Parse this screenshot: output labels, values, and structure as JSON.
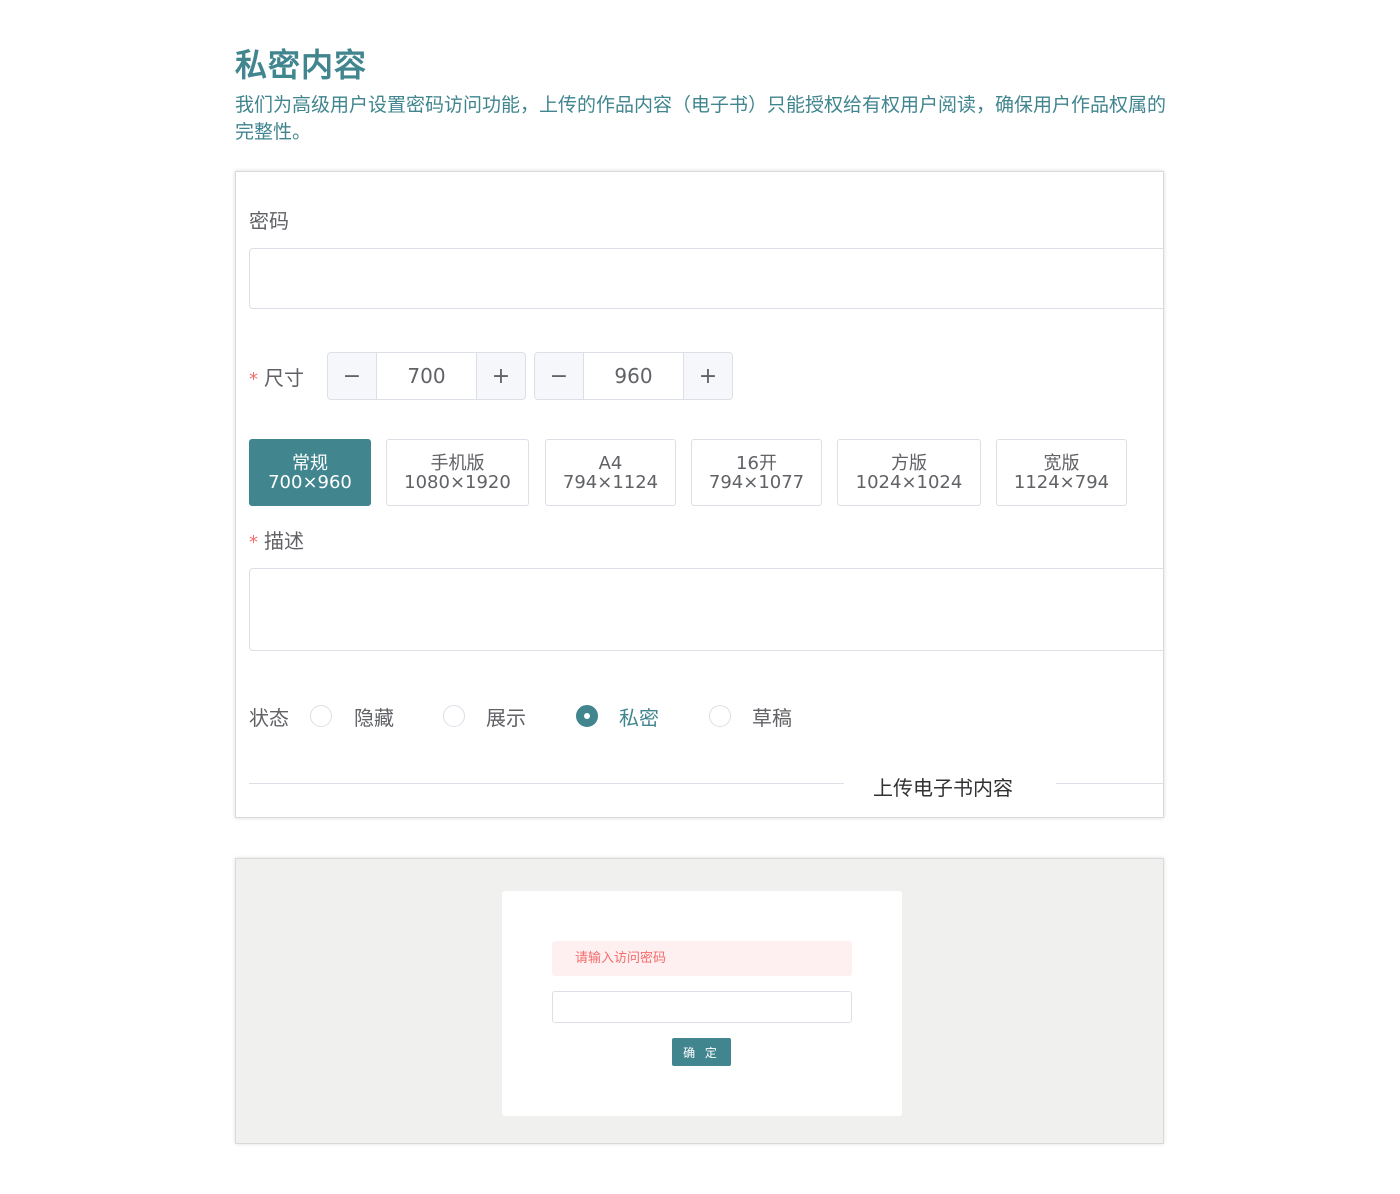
{
  "header": {
    "title": "私密内容",
    "subtitle": "我们为高级用户设置密码访问功能，上传的作品内容（电子书）只能授权给有权用户阅读，确保用户作品权属的完整性。"
  },
  "form": {
    "password_label": "密码",
    "password_value": "",
    "size_label": "尺寸",
    "required_mark": "*",
    "width": {
      "minus": "−",
      "value": "700",
      "plus": "+"
    },
    "height": {
      "minus": "−",
      "value": "960",
      "plus": "+"
    },
    "presets": [
      {
        "name": "常规",
        "dims": "700×960",
        "active": true
      },
      {
        "name": "手机版",
        "dims": "1080×1920",
        "active": false
      },
      {
        "name": "A4",
        "dims": "794×1124",
        "active": false
      },
      {
        "name": "16开",
        "dims": "794×1077",
        "active": false
      },
      {
        "name": "方版",
        "dims": "1024×1024",
        "active": false
      },
      {
        "name": "宽版",
        "dims": "1124×794",
        "active": false
      }
    ],
    "description_label": "描述",
    "description_value": "",
    "status_label": "状态",
    "status_options": [
      {
        "label": "隐藏",
        "checked": false
      },
      {
        "label": "展示",
        "checked": false
      },
      {
        "label": "私密",
        "checked": true
      },
      {
        "label": "草稿",
        "checked": false
      }
    ],
    "divider_text": "上传电子书内容"
  },
  "preview": {
    "alert_text": "请输入访问密码",
    "password_input_value": "",
    "confirm_label": "确 定"
  },
  "colors": {
    "accent": "#41858f",
    "required": "#f56c6c",
    "alert_bg": "#fef0f0"
  }
}
